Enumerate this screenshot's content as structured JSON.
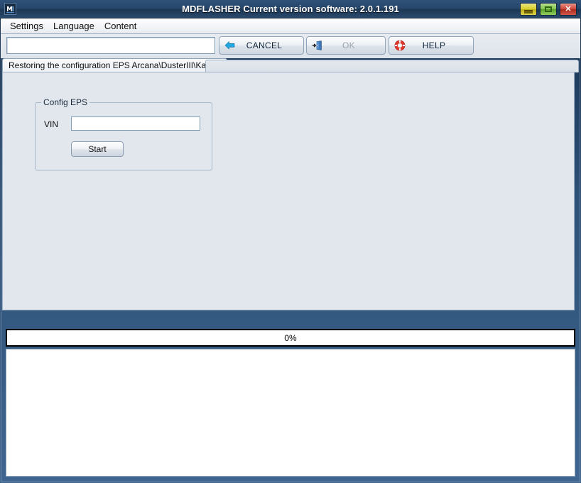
{
  "window": {
    "title": "MDFLASHER  Current version software: 2.0.1.191",
    "app_icon": "mdflasher-logo-icon",
    "controls": {
      "minimize": "minimize-icon",
      "maximize": "maximize-icon",
      "close": "close-icon"
    },
    "colors": {
      "titlebar_dark": "#1d3755",
      "titlebar_light": "#2f527a",
      "panel_bg": "#e2e7ed",
      "minimize_btn": "#d9cf33",
      "maximize_btn": "#82c44e",
      "close_btn": "#cf4a3c",
      "cancel_arrow": "#21a6e0",
      "help_ring": "#e03a2f"
    }
  },
  "menubar": {
    "items": [
      {
        "label": "Settings"
      },
      {
        "label": "Language"
      },
      {
        "label": "Content"
      }
    ]
  },
  "toolbar": {
    "path_field": {
      "value": "",
      "placeholder": ""
    },
    "buttons": [
      {
        "label": "CANCEL",
        "icon": "back-arrow-icon",
        "disabled": false
      },
      {
        "label": "OK",
        "icon": "exit-door-icon",
        "disabled": true
      },
      {
        "label": "HELP",
        "icon": "life-ring-icon",
        "disabled": false
      }
    ]
  },
  "tabs": {
    "items": [
      {
        "label": "Restoring the configuration EPS Arcana\\DusterIII\\Kaptur",
        "active": true
      }
    ]
  },
  "main": {
    "groupbox": {
      "title": "Config EPS",
      "vin_label": "VIN",
      "vin_value": "",
      "vin_placeholder": "",
      "start_label": "Start"
    }
  },
  "status": {
    "progress": {
      "percent": 0,
      "text": "0%"
    },
    "log": ""
  }
}
